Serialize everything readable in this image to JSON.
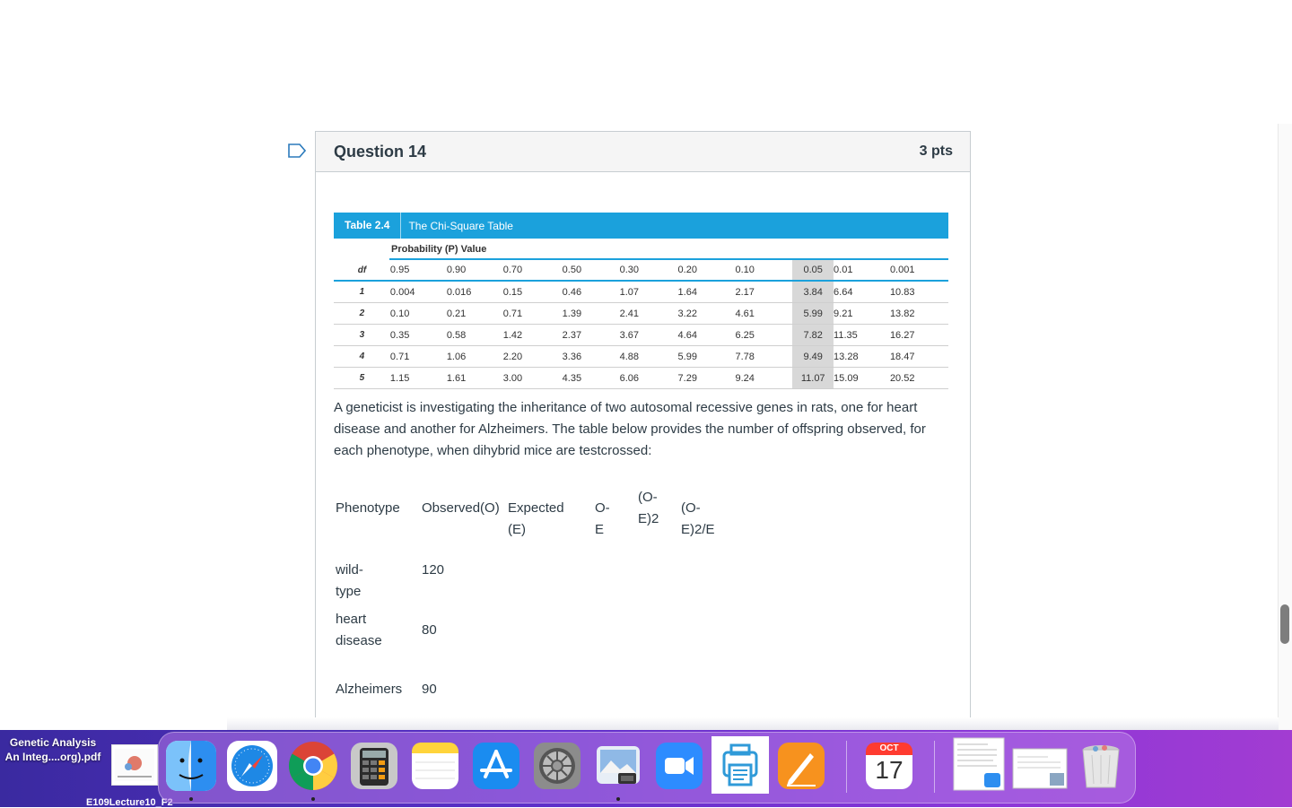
{
  "question": {
    "title": "Question 14",
    "points": "3 pts"
  },
  "chi_table": {
    "table_number": "Table 2.4",
    "table_name": "The Chi-Square Table",
    "probability_heading": "Probability (P) Value",
    "df_label": "df",
    "p_values": [
      "0.95",
      "0.90",
      "0.70",
      "0.50",
      "0.30",
      "0.20",
      "0.10",
      "0.05",
      "0.01",
      "0.001"
    ],
    "rows": [
      {
        "df": "1",
        "v": [
          "0.004",
          "0.016",
          "0.15",
          "0.46",
          "1.07",
          "1.64",
          "2.17",
          "3.84",
          "6.64",
          "10.83"
        ]
      },
      {
        "df": "2",
        "v": [
          "0.10",
          "0.21",
          "0.71",
          "1.39",
          "2.41",
          "3.22",
          "4.61",
          "5.99",
          "9.21",
          "13.82"
        ]
      },
      {
        "df": "3",
        "v": [
          "0.35",
          "0.58",
          "1.42",
          "2.37",
          "3.67",
          "4.64",
          "6.25",
          "7.82",
          "11.35",
          "16.27"
        ]
      },
      {
        "df": "4",
        "v": [
          "0.71",
          "1.06",
          "2.20",
          "3.36",
          "4.88",
          "5.99",
          "7.78",
          "9.49",
          "13.28",
          "18.47"
        ]
      },
      {
        "df": "5",
        "v": [
          "1.15",
          "1.61",
          "3.00",
          "4.35",
          "6.06",
          "7.29",
          "9.24",
          "11.07",
          "15.09",
          "20.52"
        ]
      }
    ]
  },
  "paragraph": "A geneticist is investigating the inheritance of two autosomal recessive genes in rats, one for heart disease and another for Alzheimers. The table below provides the number of  offspring observed, for each phenotype, when dihybrid mice are testcrossed:",
  "phenotype_table": {
    "headers": {
      "phenotype": "Phenotype",
      "observed": "Observed(O)",
      "expected": "Expected (E)",
      "o_minus_e": "O-E",
      "o_minus_e_sq_line1": "(O-",
      "o_minus_e_sq_line2": "E)2",
      "chi": "(O-E)2/E"
    },
    "rows": [
      {
        "phenotype": "wild-type",
        "observed": "120"
      },
      {
        "phenotype_line1": "heart",
        "phenotype_line2": "disease",
        "observed": "80"
      },
      {
        "phenotype": "Alzheimers",
        "observed": "90"
      }
    ]
  },
  "desktop": {
    "file_label_line1": "Genetic Analysis",
    "file_label_line2": "An Integ....org).pdf",
    "file2_label": "E109Lecture10_F2",
    "calendar_month": "OCT",
    "calendar_day": "17"
  },
  "dock_icons": [
    "finder-icon",
    "safari-icon",
    "chrome-icon",
    "calculator-icon",
    "notes-icon",
    "app-store-icon",
    "system-preferences-icon",
    "preview-icon",
    "zoom-icon",
    "printer-icon",
    "pages-icon",
    "calendar-icon",
    "document-icon",
    "screenshot-icon",
    "trash-icon"
  ]
}
